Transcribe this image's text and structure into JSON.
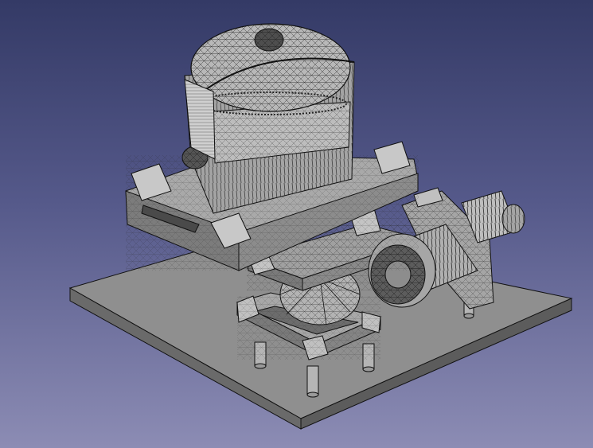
{
  "viewport": {
    "background_top": "#343a66",
    "background_bottom": "#8c8cb4"
  },
  "model": {
    "face_color": "#9d9d9d",
    "face_light": "#c2c2c2",
    "face_dark": "#6e6e6e",
    "edge_color": "#1a1a1a"
  }
}
